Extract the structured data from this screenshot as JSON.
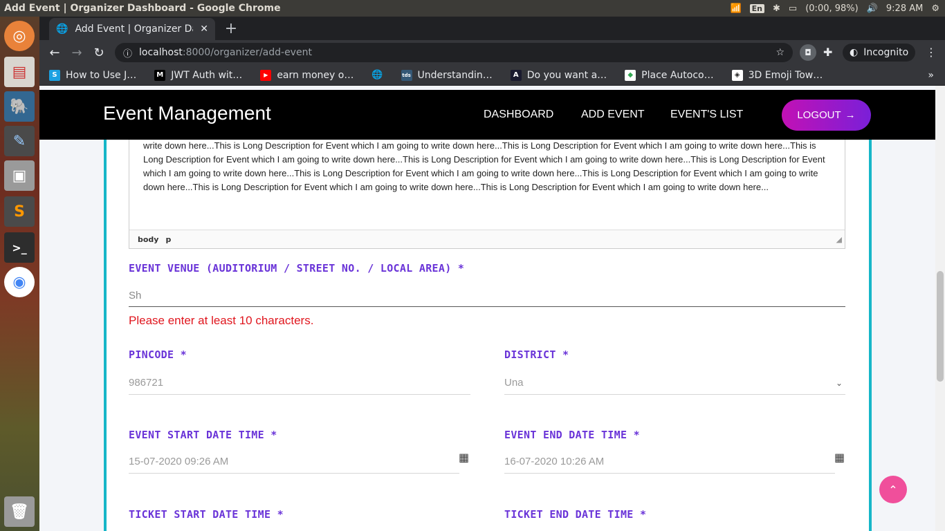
{
  "os": {
    "window_title": "Add Event | Organizer Dashboard - Google Chrome",
    "keyboard": "En",
    "battery": "(0:00, 98%)",
    "time": "9:28 AM"
  },
  "browser": {
    "tab_title": "Add Event | Organizer Dashboard - Google Chrome",
    "tab_title_visible": "Add Event | Organizer Da",
    "url_host": "localhost",
    "url_path": ":8000/organizer/add-event",
    "profile_label": "Incognito",
    "bookmarks": [
      {
        "label": "How to Use J…",
        "icon": "S",
        "color": "#1ba1e2"
      },
      {
        "label": "JWT Auth wit…",
        "icon": "M",
        "color": "#000000"
      },
      {
        "label": "earn money o…",
        "icon": "▶",
        "color": "#ff0000"
      },
      {
        "label": "Understandin…",
        "icon": "tds",
        "color": "#355876"
      },
      {
        "label": "Do you want a…",
        "icon": "A",
        "color": "#1a1a2e"
      },
      {
        "label": "Place Autoco…",
        "icon": "◆",
        "color": "#34a853"
      },
      {
        "label": "3D Emoji Tow…",
        "icon": "◈",
        "color": "#222222"
      }
    ]
  },
  "nav": {
    "brand": "Event Management",
    "links": [
      "DASHBOARD",
      "ADD EVENT",
      "EVENT'S LIST"
    ],
    "logout": "LOGOUT",
    "logout_arrow": "→"
  },
  "editor": {
    "text": "write down here...This is Long Description for Event which I am going to write down here...This is Long Description for Event which I am going to write down here...This is Long Description for Event which I am going to write down here...This is Long Description for Event which I am going to write down here...This is Long Description for Event which I am going to write down here...This is Long Description for Event which I am going to write down here...This is Long Description for Event which I am going to write down here...This is Long Description for Event which I am going to write down here...This is Long Description for Event which I am going to write down here...",
    "path": [
      "body",
      "p"
    ]
  },
  "form": {
    "venue_label": "EVENT VENUE (AUDITORIUM / STREET NO. / LOCAL AREA) *",
    "venue_value": "Sh",
    "venue_error": "Please enter at least 10 characters.",
    "pincode_label": "PINCODE *",
    "pincode_value": "986721",
    "district_label": "DISTRICT *",
    "district_value": "Una",
    "start_label": "EVENT START DATE TIME *",
    "start_value": "15-07-2020 09:26 AM",
    "end_label": "EVENT END DATE TIME *",
    "end_value": "16-07-2020 10:26 AM",
    "ticket_start_label": "TICKET START DATE TIME *",
    "ticket_end_label": "TICKET END DATE TIME *"
  }
}
